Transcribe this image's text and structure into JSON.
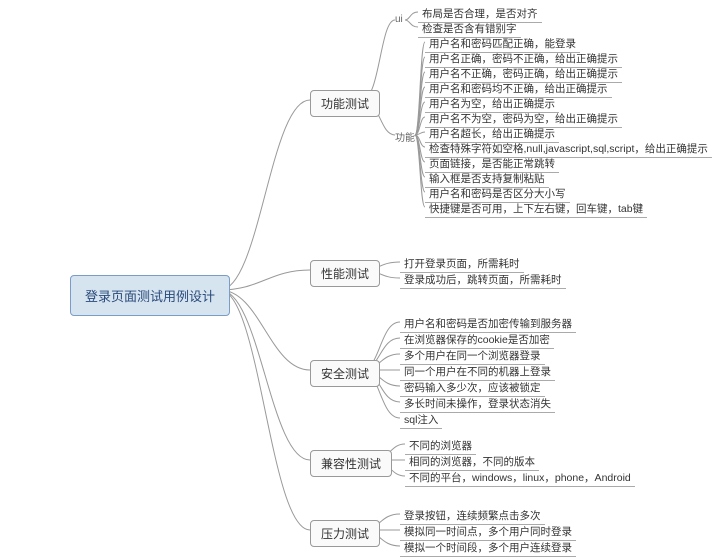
{
  "root": "登录页面测试用例设计",
  "branches": {
    "functional": {
      "label": "功能测试",
      "sub": {
        "ui": {
          "label": "ui",
          "items": [
            "布局是否合理，是否对齐",
            "检查是否含有错别字"
          ]
        },
        "func": {
          "label": "功能",
          "items": [
            "用户名和密码匹配正确，能登录",
            "用户名正确，密码不正确，给出正确提示",
            "用户名不正确，密码正确，给出正确提示",
            "用户名和密码均不正确，给出正确提示",
            "用户名为空，给出正确提示",
            "用户名不为空，密码为空，给出正确提示",
            "用户名超长，给出正确提示",
            "检查特殊字符如空格,null,javascript,sql,script，给出正确提示",
            "页面链接，是否能正常跳转",
            "输入框是否支持复制粘贴",
            "用户名和密码是否区分大小写",
            "快捷键是否可用，上下左右键，回车键，tab键"
          ]
        }
      }
    },
    "performance": {
      "label": "性能测试",
      "items": [
        "打开登录页面，所需耗时",
        "登录成功后，跳转页面，所需耗时"
      ]
    },
    "security": {
      "label": "安全测试",
      "items": [
        "用户名和密码是否加密传输到服务器",
        "在浏览器保存的cookie是否加密",
        "多个用户在同一个浏览器登录",
        "同一个用户在不同的机器上登录",
        "密码输入多少次，应该被锁定",
        "多长时间未操作，登录状态消失",
        "sql注入"
      ]
    },
    "compatibility": {
      "label": "兼容性测试",
      "items": [
        "不同的浏览器",
        "相同的浏览器，不同的版本",
        "不同的平台，windows，linux，phone，Android"
      ]
    },
    "stress": {
      "label": "压力测试",
      "items": [
        "登录按钮，连续频繁点击多次",
        "模拟同一时间点，多个用户同时登录",
        "模拟一个时间段，多个用户连续登录"
      ]
    }
  }
}
